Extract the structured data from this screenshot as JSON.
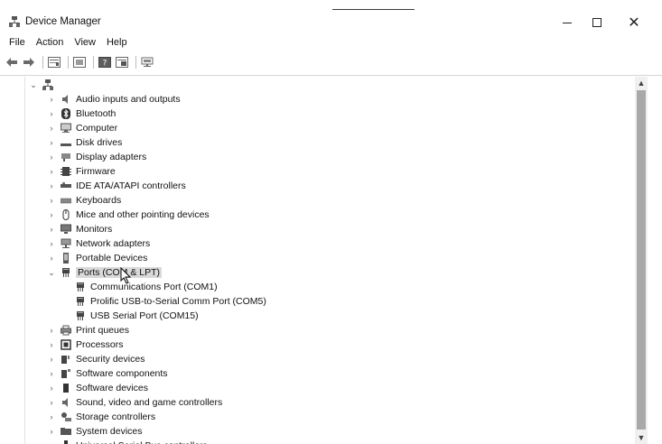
{
  "window": {
    "title": "Device Manager"
  },
  "controls": {
    "minimize": "",
    "maximize": "",
    "close": "✕"
  },
  "menu": [
    "File",
    "Action",
    "View",
    "Help"
  ],
  "toolbar": [
    "back-icon",
    "forward-icon",
    "properties-icon",
    "show-hidden-icon",
    "help-icon",
    "details-icon",
    "display-computer-icon"
  ],
  "tree": {
    "root": {
      "label": "",
      "icon": "computer-root-icon"
    },
    "items": [
      {
        "label": "Audio inputs and outputs",
        "icon": "speaker-icon",
        "expanded": false
      },
      {
        "label": "Bluetooth",
        "icon": "bluetooth-icon",
        "expanded": false
      },
      {
        "label": "Computer",
        "icon": "computer-icon",
        "expanded": false
      },
      {
        "label": "Disk drives",
        "icon": "disk-drive-icon",
        "expanded": false
      },
      {
        "label": "Display adapters",
        "icon": "display-adapter-icon",
        "expanded": false
      },
      {
        "label": "Firmware",
        "icon": "firmware-icon",
        "expanded": false
      },
      {
        "label": "IDE ATA/ATAPI controllers",
        "icon": "ide-controller-icon",
        "expanded": false
      },
      {
        "label": "Keyboards",
        "icon": "keyboard-icon",
        "expanded": false
      },
      {
        "label": "Mice and other pointing devices",
        "icon": "mouse-icon",
        "expanded": false
      },
      {
        "label": "Monitors",
        "icon": "monitor-icon",
        "expanded": false
      },
      {
        "label": "Network adapters",
        "icon": "network-adapter-icon",
        "expanded": false
      },
      {
        "label": "Portable Devices",
        "icon": "portable-device-icon",
        "expanded": false
      },
      {
        "label": "Ports (COM & LPT)",
        "icon": "port-icon",
        "expanded": true,
        "selected": true,
        "children": [
          {
            "label": "Communications Port (COM1)",
            "icon": "port-icon"
          },
          {
            "label": "Prolific USB-to-Serial Comm Port (COM5)",
            "icon": "port-icon"
          },
          {
            "label": "USB Serial Port (COM15)",
            "icon": "port-icon"
          }
        ]
      },
      {
        "label": "Print queues",
        "icon": "printer-icon",
        "expanded": false
      },
      {
        "label": "Processors",
        "icon": "processor-icon",
        "expanded": false
      },
      {
        "label": "Security devices",
        "icon": "security-device-icon",
        "expanded": false
      },
      {
        "label": "Software components",
        "icon": "software-component-icon",
        "expanded": false
      },
      {
        "label": "Software devices",
        "icon": "software-device-icon",
        "expanded": false
      },
      {
        "label": "Sound, video and game controllers",
        "icon": "sound-icon",
        "expanded": false
      },
      {
        "label": "Storage controllers",
        "icon": "storage-controller-icon",
        "expanded": false
      },
      {
        "label": "System devices",
        "icon": "system-device-icon",
        "expanded": false
      },
      {
        "label": "Universal Serial Bus controllers",
        "icon": "usb-icon",
        "expanded": false
      }
    ]
  }
}
